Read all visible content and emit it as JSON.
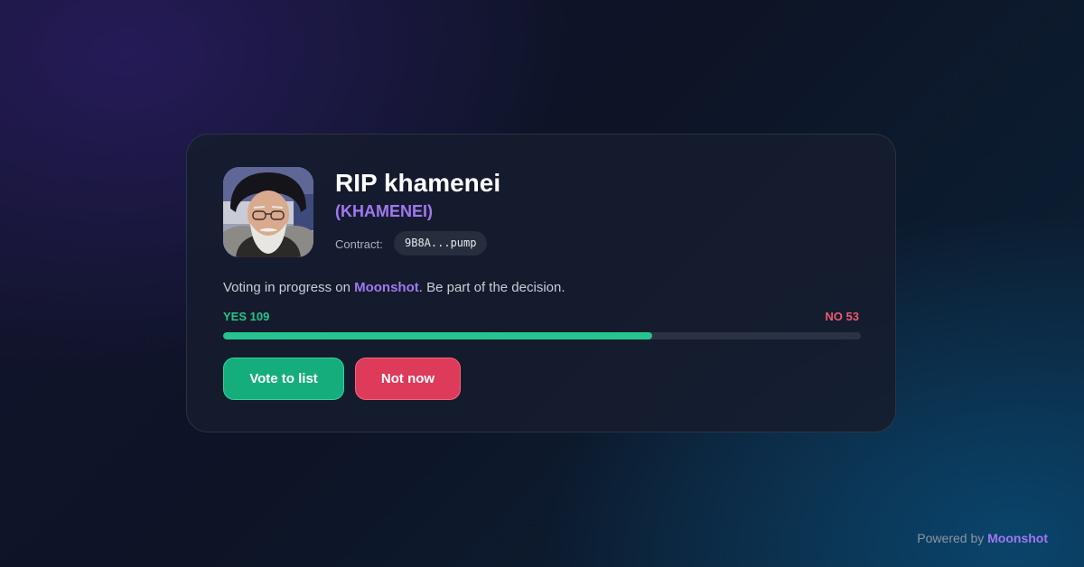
{
  "token": {
    "name": "RIP khamenei",
    "symbol": "(KHAMENEI)",
    "contract_label": "Contract:",
    "contract_address": "9B8A...pump",
    "avatar_icon": "portrait-photo"
  },
  "voting": {
    "text_before": "Voting in progress on ",
    "platform": "Moonshot",
    "text_after": ". Be part of the decision.",
    "yes_label": "YES 109",
    "no_label": "NO 53",
    "yes_count": 109,
    "no_count": 53
  },
  "actions": {
    "vote_label": "Vote to list",
    "decline_label": "Not now"
  },
  "footer": {
    "prefix": "Powered by ",
    "brand": "Moonshot"
  },
  "colors": {
    "yes": "#26c48e",
    "no": "#ee5a6e",
    "accent": "#a078f0"
  }
}
